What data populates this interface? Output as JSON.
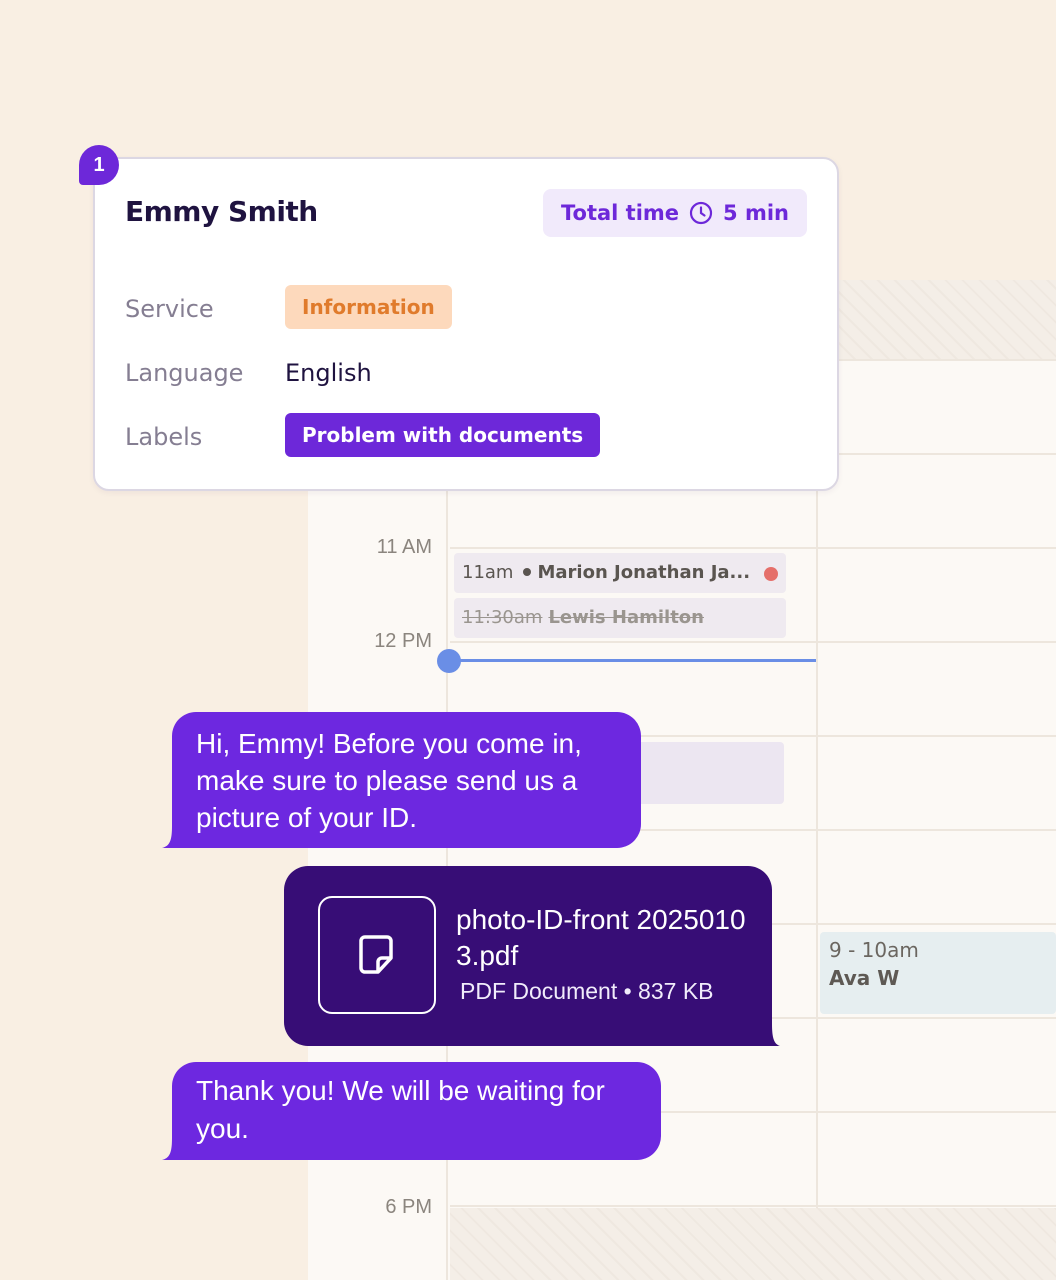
{
  "card": {
    "step_number": "1",
    "name": "Emmy Smith",
    "total_time_label": "Total time",
    "total_time_value": "5 min",
    "service_label": "Service",
    "service_value": "Information",
    "language_label": "Language",
    "language_value": "English",
    "labels_label": "Labels",
    "labels_value": "Problem with documents",
    "colors": {
      "accent": "#6d28d9",
      "service_chip_bg": "#fdd9bc",
      "service_chip_text": "#e07b2c"
    }
  },
  "calendar": {
    "times": {
      "t11": "11 AM",
      "t12": "12 PM",
      "t6": "6 PM"
    },
    "events": [
      {
        "time": "11am",
        "name": "Marion Jonathan Ja...",
        "status_color": "#e56f6a"
      },
      {
        "time": "11:30am",
        "name": "Lewis Hamilton",
        "cancelled": true
      },
      {
        "time": "9 - 10am",
        "name": "Ava W"
      }
    ],
    "now_line_color": "#6a8ee6"
  },
  "chat": {
    "message_1": "Hi, Emmy! Before you come in, make sure to please send us a picture of your ID.",
    "attachment": {
      "file_name": "photo-ID-front 20250103.pdf",
      "file_meta": "PDF Document • 837 KB",
      "icon": "document-icon"
    },
    "message_2": "Thank you! We will be waiting for you."
  }
}
